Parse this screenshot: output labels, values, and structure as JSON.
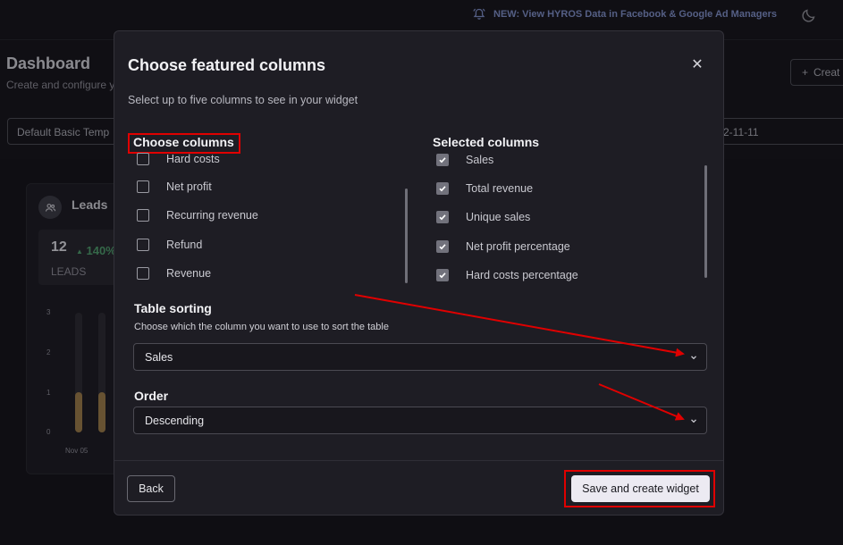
{
  "topbar": {
    "announcement": "NEW: View HYROS Data in Facebook & Google Ad Managers",
    "announcement_icon": "bell-ring-icon",
    "theme_icon": "moon-icon"
  },
  "background": {
    "title": "Dashboard",
    "subtitle": "Create and configure y",
    "create_label": "Creat",
    "template_value": "Default Basic Temp",
    "date_value": "2-11-11",
    "leads_widget": {
      "title": "Leads",
      "value": "12",
      "change": "140%",
      "label": "LEADS",
      "y_ticks": [
        "3",
        "2",
        "1",
        "0"
      ],
      "x_label": "Nov 05",
      "bars": [
        1,
        1
      ]
    }
  },
  "modal": {
    "title": "Choose featured columns",
    "subtitle": "Select up to five columns to see in your widget",
    "choose_heading": "Choose columns",
    "selected_heading": "Selected columns",
    "available_columns": [
      {
        "label": "Hard costs",
        "checked": false
      },
      {
        "label": "Net profit",
        "checked": false
      },
      {
        "label": "Recurring revenue",
        "checked": false
      },
      {
        "label": "Refund",
        "checked": false
      },
      {
        "label": "Revenue",
        "checked": false
      }
    ],
    "selected_columns": [
      {
        "label": "Sales",
        "checked": true
      },
      {
        "label": "Total revenue",
        "checked": true
      },
      {
        "label": "Unique sales",
        "checked": true
      },
      {
        "label": "Net profit percentage",
        "checked": true
      },
      {
        "label": "Hard costs percentage",
        "checked": true
      }
    ],
    "sorting": {
      "title": "Table sorting",
      "subtitle": "Choose which the column you want to use to sort the table",
      "value": "Sales"
    },
    "order": {
      "title": "Order",
      "value": "Descending"
    },
    "back_label": "Back",
    "save_label": "Save and create widget"
  },
  "colors": {
    "highlight": "#e00000",
    "arrow": "#e00000",
    "modal_bg": "#1e1d24",
    "page_bg": "#131218"
  }
}
